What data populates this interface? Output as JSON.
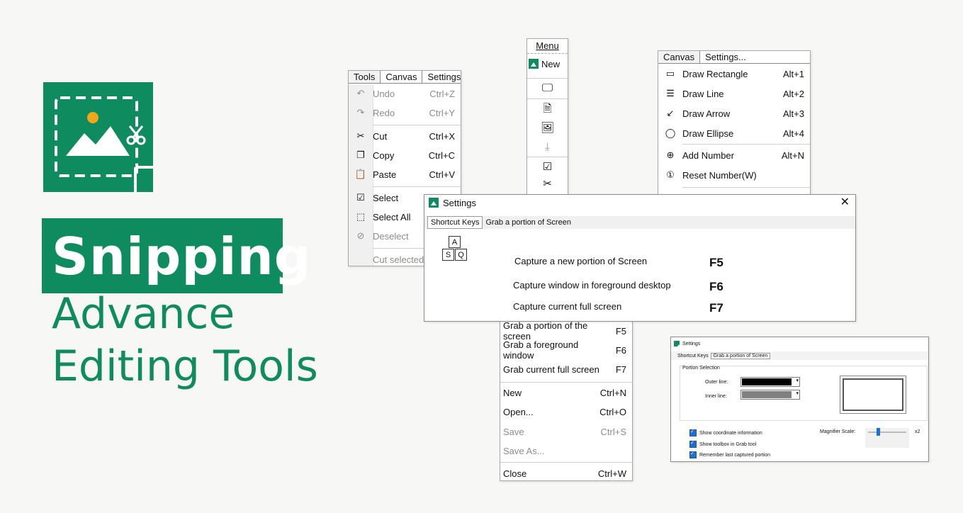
{
  "hero": {
    "title": "Snipping",
    "subtitle_line1": "Advance",
    "subtitle_line2": "Editing Tools",
    "brand_color": "#0e8c5f"
  },
  "tools_menu": {
    "menubar": [
      "Tools",
      "Canvas",
      "Settings..."
    ],
    "items": [
      {
        "label": "Undo",
        "key": "Ctrl+Z",
        "icon": "undo-icon",
        "disabled": true
      },
      {
        "label": "Redo",
        "key": "Ctrl+Y",
        "icon": "redo-icon",
        "disabled": true
      },
      {
        "label": "Cut",
        "key": "Ctrl+X",
        "icon": "cut-icon",
        "disabled": false
      },
      {
        "label": "Copy",
        "key": "Ctrl+C",
        "icon": "copy-icon",
        "disabled": false
      },
      {
        "label": "Paste",
        "key": "Ctrl+V",
        "icon": "paste-icon",
        "disabled": false
      },
      {
        "label": "Select",
        "key": "",
        "icon": "select-icon",
        "disabled": false
      },
      {
        "label": "Select All",
        "key": "",
        "icon": "select-all-icon",
        "disabled": false
      },
      {
        "label": "Deselect",
        "key": "",
        "icon": "deselect-icon",
        "disabled": true
      },
      {
        "label": "Cut selected",
        "key": "",
        "icon": "",
        "disabled": true
      }
    ]
  },
  "menu_toolbar": {
    "title": "Menu",
    "new_label": "New",
    "icons": [
      "monitor-icon",
      "document-icon",
      "image-icon",
      "download-icon",
      "checkbox-icon",
      "cut-icon"
    ]
  },
  "canvas_menu": {
    "menubar": [
      "Canvas",
      "Settings..."
    ],
    "items": [
      {
        "label": "Draw Rectangle",
        "key": "Alt+1",
        "icon": "rectangle-icon"
      },
      {
        "label": "Draw Line",
        "key": "Alt+2",
        "icon": "line-icon"
      },
      {
        "label": "Draw Arrow",
        "key": "Alt+3",
        "icon": "arrow-icon"
      },
      {
        "label": "Draw Ellipse",
        "key": "Alt+4",
        "icon": "ellipse-icon"
      },
      {
        "label": "Add Number",
        "key": "Alt+N",
        "icon": "add-number-icon"
      },
      {
        "label": "Reset Number(W)",
        "key": "",
        "icon": "reset-number-icon"
      }
    ]
  },
  "settings_dialog": {
    "title": "Settings",
    "tabs": [
      "Shortcut Keys",
      "Grab a portion of Screen"
    ],
    "keycaps": [
      "A",
      "S",
      "Q"
    ],
    "shortcuts": [
      {
        "label": "Capture a new portion of Screen",
        "key": "F5"
      },
      {
        "label": "Capture window in foreground desktop",
        "key": "F6"
      },
      {
        "label": "Capture current full screen",
        "key": "F7"
      }
    ]
  },
  "file_menu": {
    "items": [
      {
        "label": "Grab a portion of the screen",
        "key": "F5",
        "disabled": false
      },
      {
        "label": "Grab a foreground window",
        "key": "F6",
        "disabled": false
      },
      {
        "label": "Grab current full screen",
        "key": "F7",
        "disabled": false
      },
      {
        "label": "New",
        "key": "Ctrl+N",
        "disabled": false
      },
      {
        "label": "Open...",
        "key": "Ctrl+O",
        "disabled": false
      },
      {
        "label": "Save",
        "key": "Ctrl+S",
        "disabled": true
      },
      {
        "label": "Save As...",
        "key": "",
        "disabled": true
      },
      {
        "label": "Close",
        "key": "Ctrl+W",
        "disabled": false
      }
    ]
  },
  "settings_small": {
    "title": "Settings",
    "tabs": [
      "Shortcut Keys",
      "Grab a portion of Screen"
    ],
    "group_label": "Portion Selection",
    "outer_line_label": "Outer line:",
    "inner_line_label": "Inner line:",
    "outer_color": "#000000",
    "inner_color": "#808080",
    "checkboxes": [
      "Show coordinate information",
      "Show toolbox in Grab tool",
      "Remember last captured portion"
    ],
    "magnifier_label": "Magnifier Scale:",
    "magnifier_value": "x2"
  }
}
